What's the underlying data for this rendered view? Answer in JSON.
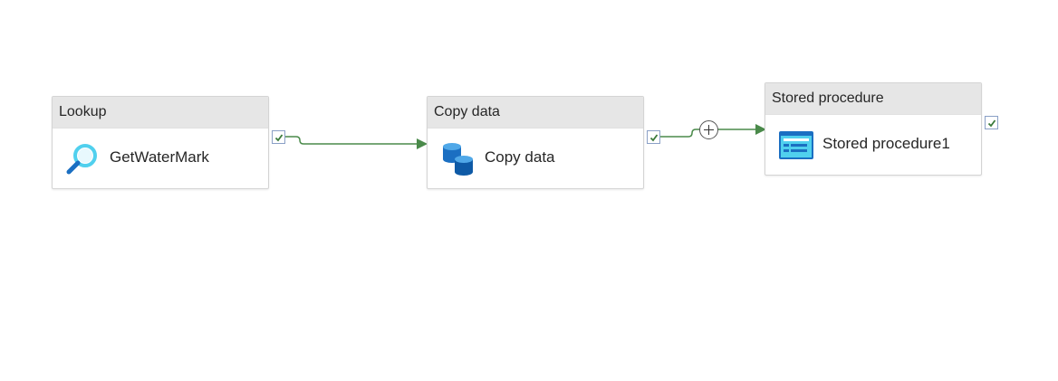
{
  "pipeline": {
    "activities": [
      {
        "type_label": "Lookup",
        "name": "GetWaterMark",
        "icon": "lookup-magnifier-icon",
        "status": "success"
      },
      {
        "type_label": "Copy data",
        "name": "Copy data",
        "icon": "copy-data-icon",
        "status": "success"
      },
      {
        "type_label": "Stored procedure",
        "name": "Stored procedure1",
        "icon": "stored-procedure-icon",
        "status": "success"
      }
    ],
    "connections": [
      {
        "from": "GetWaterMark",
        "to": "Copy data",
        "condition": "success"
      },
      {
        "from": "Copy data",
        "to": "Stored procedure1",
        "condition": "success"
      }
    ],
    "colors": {
      "success_connector": "#4a8a4a",
      "icon_blue": "#1b6fc2",
      "icon_cyan": "#50d0ee",
      "header_bg": "#e6e6e6"
    }
  }
}
